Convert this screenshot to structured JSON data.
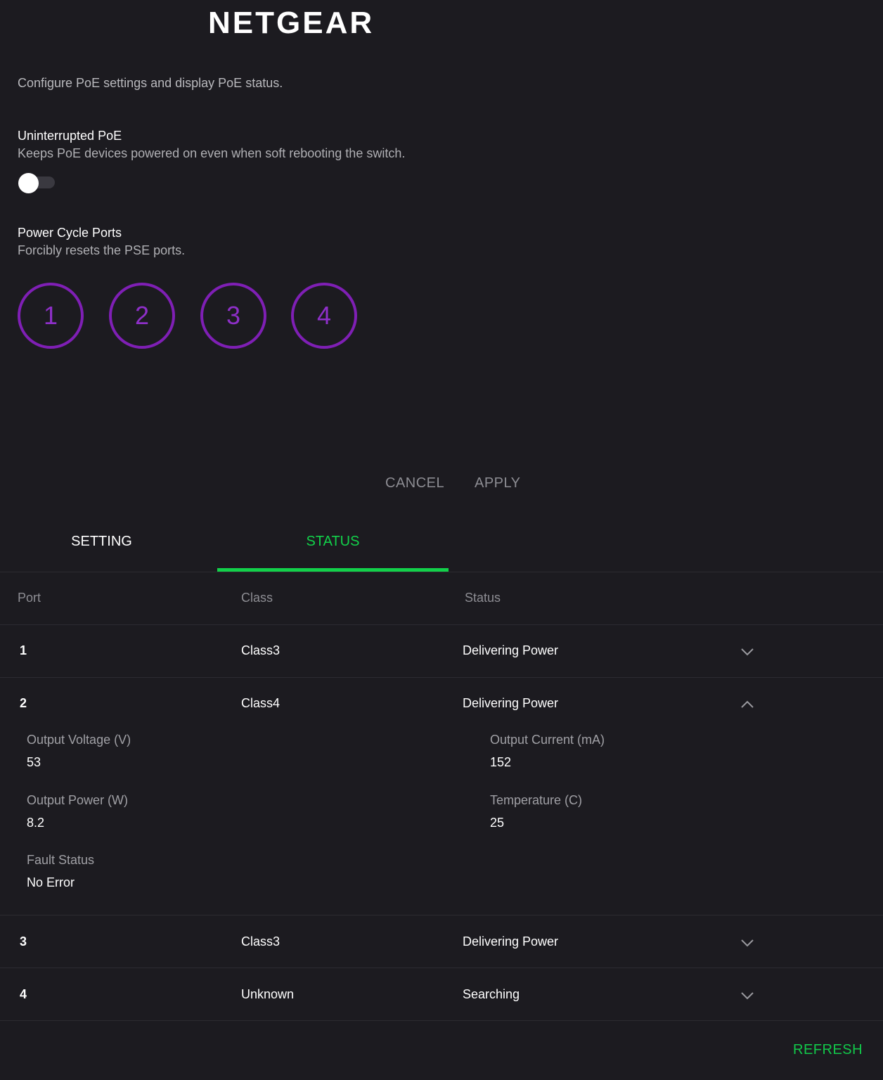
{
  "brand": {
    "logo_text": "NETGEAR"
  },
  "page": {
    "description": "Configure PoE settings and display PoE status."
  },
  "uninterrupted_poe": {
    "title": "Uninterrupted PoE",
    "subtitle": "Keeps PoE devices powered on even when soft rebooting the switch.",
    "toggle_on": false
  },
  "power_cycle": {
    "title": "Power Cycle Ports",
    "subtitle": "Forcibly resets the PSE ports.",
    "ports": [
      "1",
      "2",
      "3",
      "4"
    ],
    "accent_color": "#7f1fb5"
  },
  "actions": {
    "cancel": "CANCEL",
    "apply": "APPLY"
  },
  "tabs": [
    {
      "label": "SETTING",
      "active": false
    },
    {
      "label": "STATUS",
      "active": true
    }
  ],
  "table": {
    "headers": {
      "port": "Port",
      "class": "Class",
      "status": "Status"
    },
    "rows": [
      {
        "port": "1",
        "class": "Class3",
        "status": "Delivering Power",
        "expanded": false
      },
      {
        "port": "2",
        "class": "Class4",
        "status": "Delivering Power",
        "expanded": true
      },
      {
        "port": "3",
        "class": "Class3",
        "status": "Delivering Power",
        "expanded": false
      },
      {
        "port": "4",
        "class": "Unknown",
        "status": "Searching",
        "expanded": false
      }
    ],
    "details": {
      "voltage_label": "Output Voltage (V)",
      "voltage_value": "53",
      "current_label": "Output Current (mA)",
      "current_value": "152",
      "power_label": "Output Power (W)",
      "power_value": "8.2",
      "temp_label": "Temperature (C)",
      "temp_value": "25",
      "fault_label": "Fault Status",
      "fault_value": "No Error"
    }
  },
  "refresh": {
    "label": "REFRESH"
  },
  "colors": {
    "background": "#1c1b20",
    "active_tab": "#12d14a",
    "refresh": "#12c94a"
  }
}
